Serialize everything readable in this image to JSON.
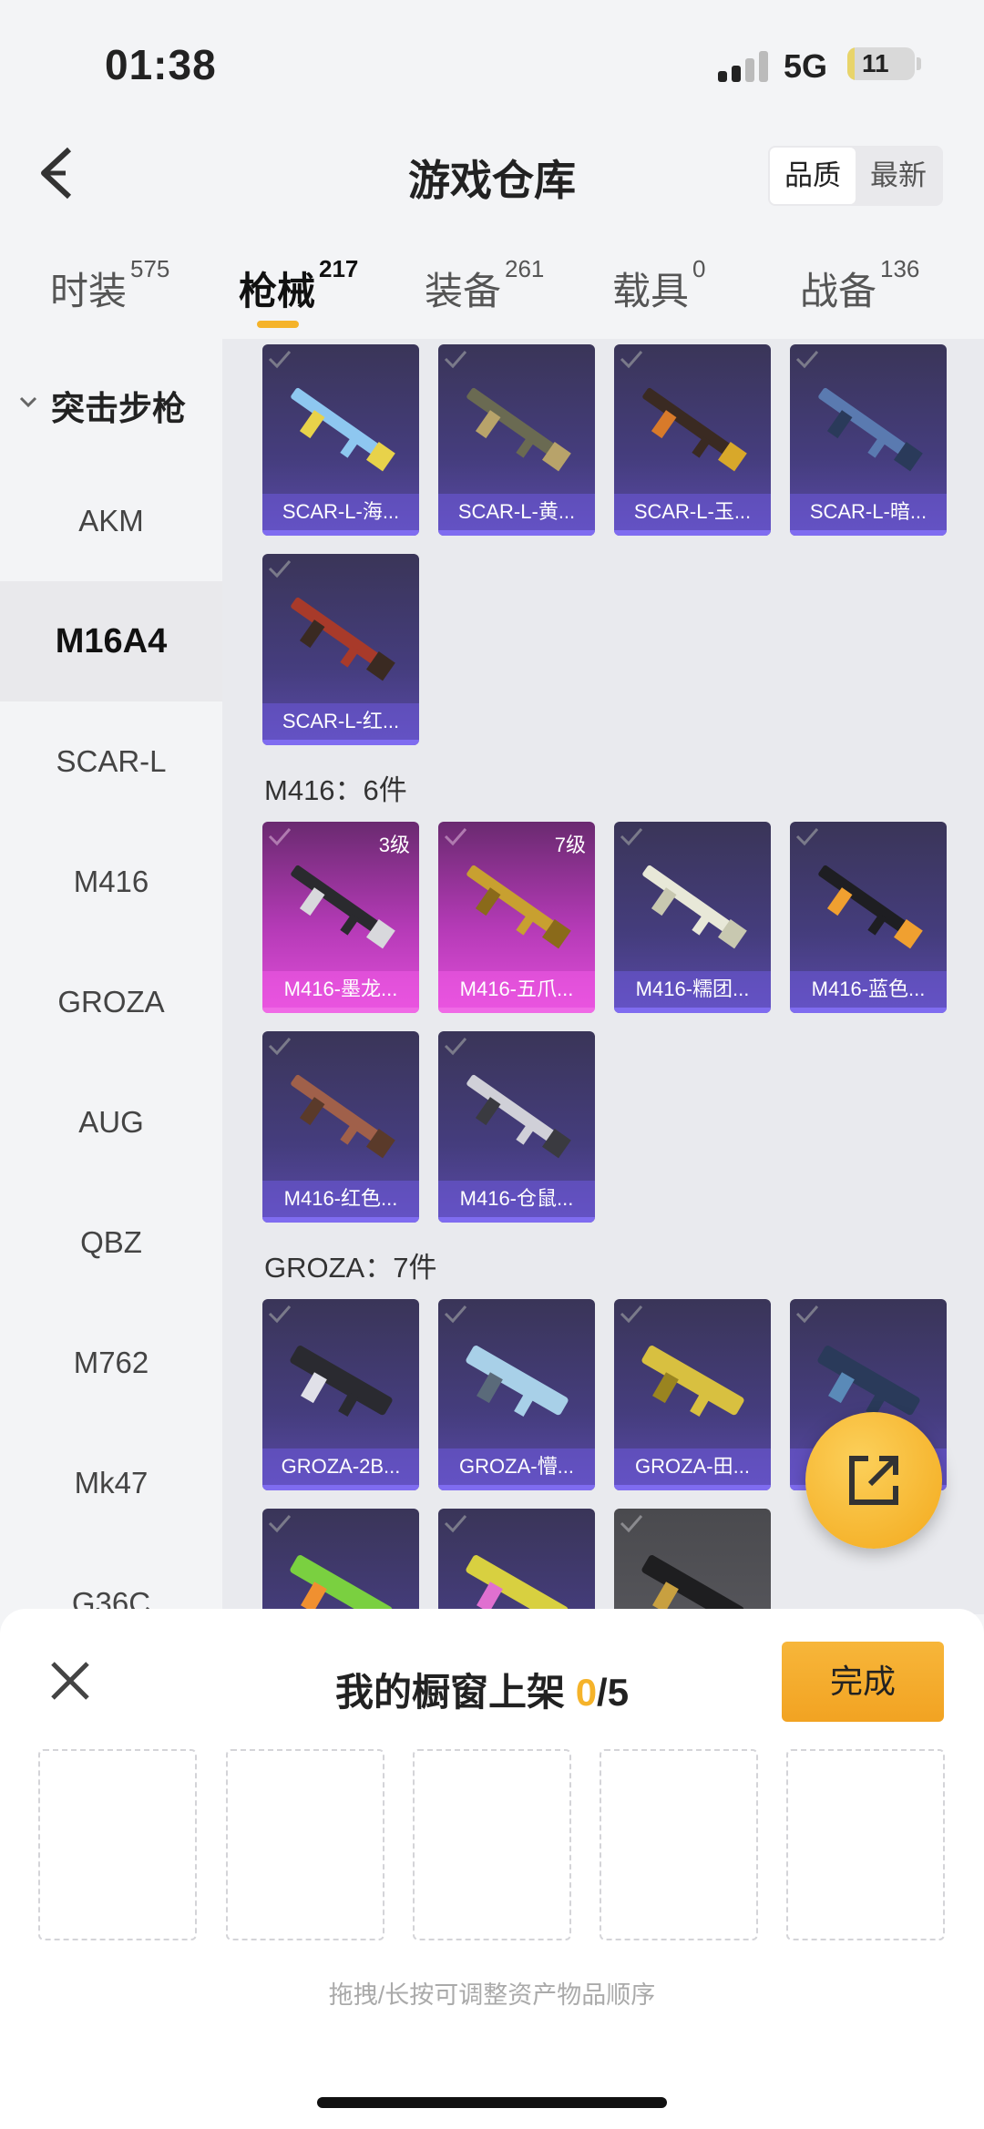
{
  "status": {
    "time": "01:38",
    "network": "5G",
    "battery": "11",
    "battery_level": 0.11
  },
  "header": {
    "title": "游戏仓库",
    "sort_options": [
      "品质",
      "最新"
    ],
    "sort_selected": "品质"
  },
  "tabs": [
    {
      "label": "时装",
      "count": "575"
    },
    {
      "label": "枪械",
      "count": "217",
      "active": true
    },
    {
      "label": "装备",
      "count": "261"
    },
    {
      "label": "载具",
      "count": "0"
    },
    {
      "label": "战备",
      "count": "136"
    }
  ],
  "sidebar": {
    "group": "突击步枪",
    "items": [
      "AKM",
      "M16A4",
      "SCAR-L",
      "M416",
      "GROZA",
      "AUG",
      "QBZ",
      "M762",
      "Mk47",
      "G36C"
    ],
    "selected": "M16A4"
  },
  "sections": {
    "scar": {
      "cards": [
        "SCAR-L-海...",
        "SCAR-L-黄...",
        "SCAR-L-玉...",
        "SCAR-L-暗...",
        "SCAR-L-红..."
      ]
    },
    "m416": {
      "title": "M416：6件",
      "cards": [
        "M416-墨龙...",
        "M416-五爪...",
        "M416-糯团...",
        "M416-蓝色...",
        "M416-红色...",
        "M416-仓鼠..."
      ],
      "levels": [
        "3级",
        "7级"
      ]
    },
    "groza": {
      "title": "GROZA：7件",
      "cards": [
        "GROZA-2B...",
        "GROZA-懵...",
        "GROZA-田...",
        ""
      ]
    }
  },
  "sheet": {
    "title": "我的橱窗上架",
    "count": "0",
    "total": "/5",
    "done": "完成",
    "hint": "拖拽/长按可调整资产物品顺序"
  }
}
